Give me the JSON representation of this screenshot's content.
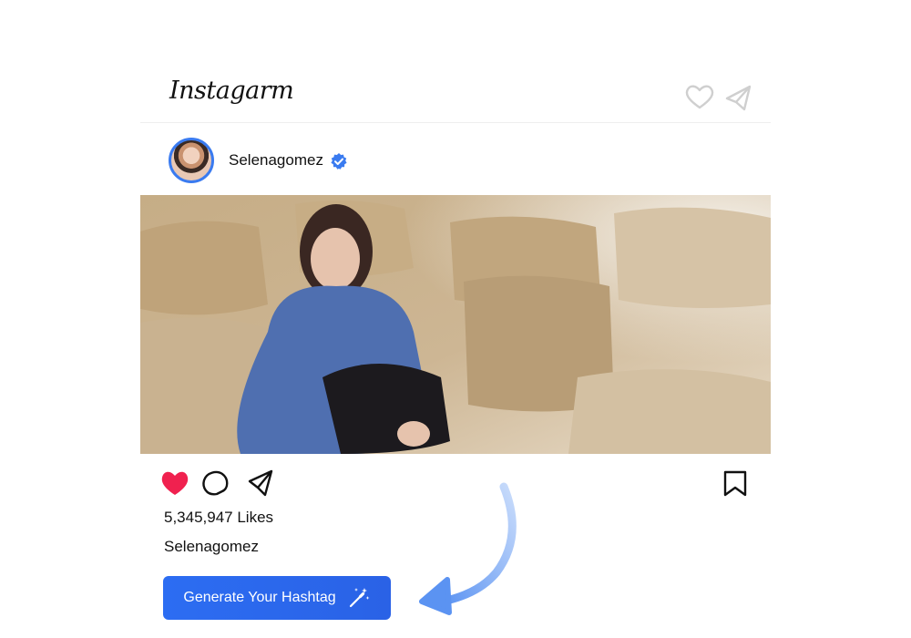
{
  "header": {
    "logo_text": "Instagarm",
    "icons": [
      "heart-outline-icon",
      "paper-plane-icon"
    ]
  },
  "post": {
    "username": "Selenagomez",
    "verified": true,
    "image_description": "",
    "likes_text": "5,345,947 Likes",
    "caption_username": "Selenagomez",
    "actions": [
      "heart-filled-icon",
      "comment-icon",
      "share-icon",
      "bookmark-icon"
    ],
    "liked": true
  },
  "cta": {
    "label": "Generate Your Hashtag",
    "icon": "magic-wand-icon"
  },
  "colors": {
    "accent": "#2c6df2",
    "like": "#f0214f",
    "verified": "#3a7bf0",
    "arrow": "#6fa3f5"
  }
}
